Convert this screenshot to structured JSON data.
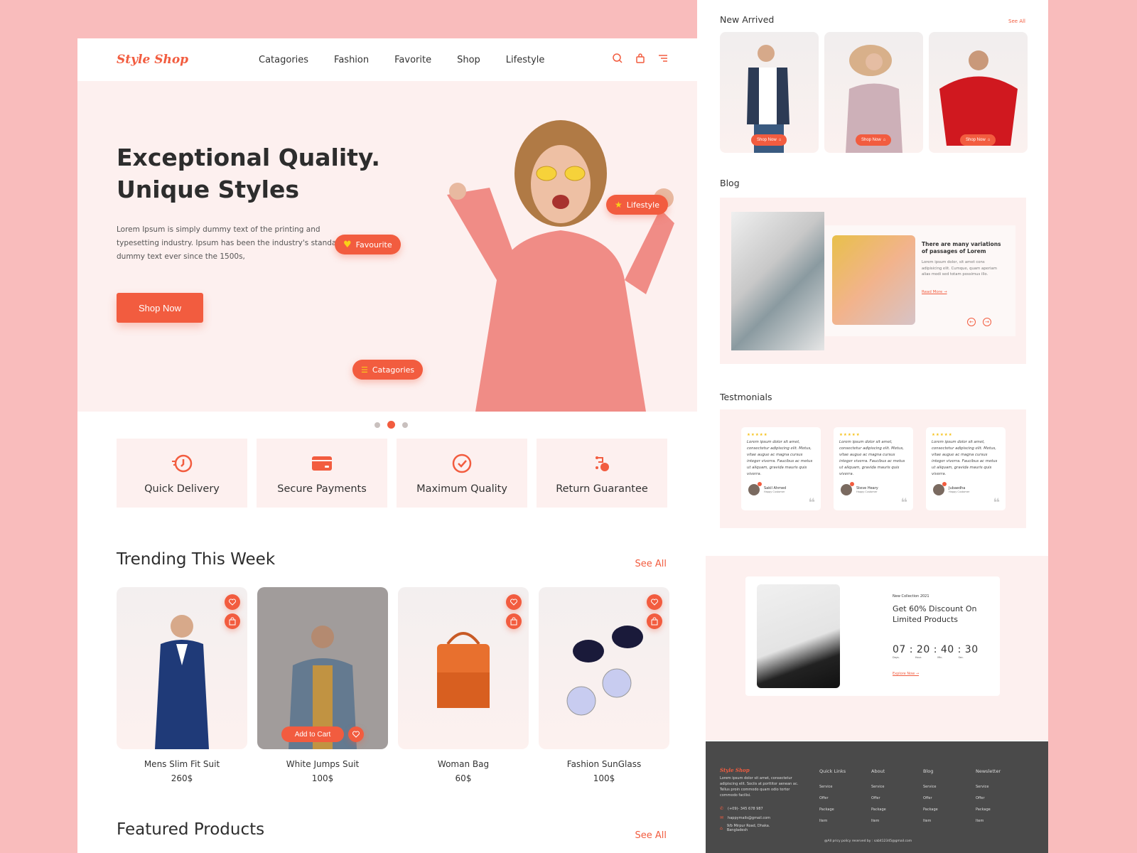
{
  "brand": "Style Shop",
  "nav": {
    "items": [
      "Catagories",
      "Fashion",
      "Favorite",
      "Shop",
      "Lifestyle"
    ]
  },
  "hero": {
    "title": "Exceptional Quality. Unique Styles",
    "desc": "Lorem Ipsum is simply dummy text of the printing and typesetting industry. Ipsum has been the industry's standard dummy text ever since the 1500s,",
    "cta": "Shop Now",
    "tags": {
      "favourite": "Favourite",
      "lifestyle": "Lifestyle",
      "categories": "Catagories"
    },
    "slides": {
      "count": 3,
      "active": 2
    }
  },
  "features": [
    "Quick Delivery",
    "Secure Payments",
    "Maximum Quality",
    "Return Guarantee"
  ],
  "trending": {
    "title": "Trending This Week",
    "see_all": "See All",
    "add_to_cart": "Add to Cart",
    "products": [
      {
        "name": "Mens Slim Fit Suit",
        "price": "260$"
      },
      {
        "name": "White Jumps Suit",
        "price": "100$"
      },
      {
        "name": "Woman Bag",
        "price": "60$"
      },
      {
        "name": "Fashion SunGlass",
        "price": "100$"
      }
    ]
  },
  "featured": {
    "title": "Featured Products",
    "see_all": "See All"
  },
  "new_arrived": {
    "title": "New Arrived",
    "see_all": "See All",
    "shop_now": "Shop Now"
  },
  "blog": {
    "title": "Blog",
    "post_title": "There are many variations of passages of Lorem",
    "post_text": "Lorem ipsum dolor, sit amet cons adipisicing elit. Cumque, quam aperiam alias modi sed totam possimus illo.",
    "read_more": "Read More →"
  },
  "testimonials": {
    "title": "Testmonials",
    "text": "Lorem ipsum dolor sit amet, consectetur adipiscing elit. Metus, vitae augue ac magna cursus integer viverra. Faucibus ac metus ut aliquam, gravida mauris quis viverra.",
    "items": [
      {
        "name": "Sakil Ahmed",
        "role": "Happy Customer",
        "stars": 5
      },
      {
        "name": "Steve Heary",
        "role": "Happy Customer",
        "stars": 5
      },
      {
        "name": "Jubaedha",
        "role": "Happy Customer",
        "stars": 5
      }
    ]
  },
  "promo": {
    "eyebrow": "New Collection 2021",
    "title": "Get 60% Discount On Limited Products",
    "timer": "07 : 20  : 40 : 30",
    "labels": [
      "Days.",
      "Hour.",
      "Min.",
      "Sec."
    ],
    "cta": "Explore Now →"
  },
  "footer": {
    "desc": "Lorem ipsum dolor sit amet, consectetur adipiscing elit. Sociis at porttitor aenean ac. Tellus proin commodo quam odio tortor commodo facilisi.",
    "phone": "(+09)- 345 678 987",
    "email": "happymails@gmail.com",
    "address": "9/b Mirpur Road, Dhaka. Bangladesh",
    "columns": [
      {
        "title": "Quick Links",
        "links": [
          "Service",
          "Offer",
          "Package",
          "Item"
        ]
      },
      {
        "title": "About",
        "links": [
          "Service",
          "Offer",
          "Package",
          "Item"
        ]
      },
      {
        "title": "Blog",
        "links": [
          "Service",
          "Offer",
          "Package",
          "Item"
        ]
      },
      {
        "title": "Newsletter",
        "links": [
          "Service",
          "Offer",
          "Package",
          "Item"
        ]
      }
    ],
    "copyright": "@All pricy policy reserved by : sabit12345@gmail.com"
  }
}
